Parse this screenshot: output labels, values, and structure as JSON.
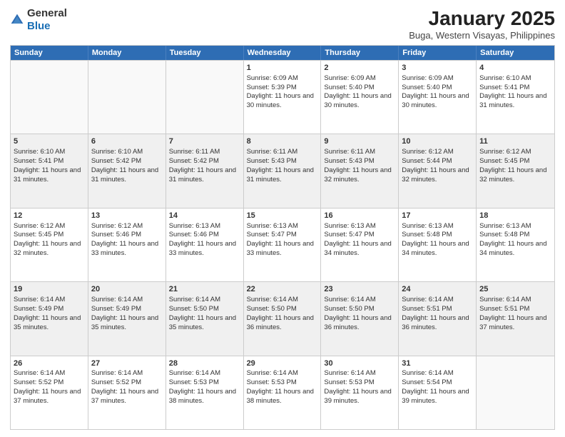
{
  "header": {
    "logo_general": "General",
    "logo_blue": "Blue",
    "title": "January 2025",
    "subtitle": "Buga, Western Visayas, Philippines"
  },
  "weekdays": [
    "Sunday",
    "Monday",
    "Tuesday",
    "Wednesday",
    "Thursday",
    "Friday",
    "Saturday"
  ],
  "weeks": [
    [
      {
        "day": "",
        "sunrise": "",
        "sunset": "",
        "daylight": "",
        "empty": true
      },
      {
        "day": "",
        "sunrise": "",
        "sunset": "",
        "daylight": "",
        "empty": true
      },
      {
        "day": "",
        "sunrise": "",
        "sunset": "",
        "daylight": "",
        "empty": true
      },
      {
        "day": "1",
        "sunrise": "Sunrise: 6:09 AM",
        "sunset": "Sunset: 5:39 PM",
        "daylight": "Daylight: 11 hours and 30 minutes.",
        "empty": false
      },
      {
        "day": "2",
        "sunrise": "Sunrise: 6:09 AM",
        "sunset": "Sunset: 5:40 PM",
        "daylight": "Daylight: 11 hours and 30 minutes.",
        "empty": false
      },
      {
        "day": "3",
        "sunrise": "Sunrise: 6:09 AM",
        "sunset": "Sunset: 5:40 PM",
        "daylight": "Daylight: 11 hours and 30 minutes.",
        "empty": false
      },
      {
        "day": "4",
        "sunrise": "Sunrise: 6:10 AM",
        "sunset": "Sunset: 5:41 PM",
        "daylight": "Daylight: 11 hours and 31 minutes.",
        "empty": false
      }
    ],
    [
      {
        "day": "5",
        "sunrise": "Sunrise: 6:10 AM",
        "sunset": "Sunset: 5:41 PM",
        "daylight": "Daylight: 11 hours and 31 minutes.",
        "empty": false
      },
      {
        "day": "6",
        "sunrise": "Sunrise: 6:10 AM",
        "sunset": "Sunset: 5:42 PM",
        "daylight": "Daylight: 11 hours and 31 minutes.",
        "empty": false
      },
      {
        "day": "7",
        "sunrise": "Sunrise: 6:11 AM",
        "sunset": "Sunset: 5:42 PM",
        "daylight": "Daylight: 11 hours and 31 minutes.",
        "empty": false
      },
      {
        "day": "8",
        "sunrise": "Sunrise: 6:11 AM",
        "sunset": "Sunset: 5:43 PM",
        "daylight": "Daylight: 11 hours and 31 minutes.",
        "empty": false
      },
      {
        "day": "9",
        "sunrise": "Sunrise: 6:11 AM",
        "sunset": "Sunset: 5:43 PM",
        "daylight": "Daylight: 11 hours and 32 minutes.",
        "empty": false
      },
      {
        "day": "10",
        "sunrise": "Sunrise: 6:12 AM",
        "sunset": "Sunset: 5:44 PM",
        "daylight": "Daylight: 11 hours and 32 minutes.",
        "empty": false
      },
      {
        "day": "11",
        "sunrise": "Sunrise: 6:12 AM",
        "sunset": "Sunset: 5:45 PM",
        "daylight": "Daylight: 11 hours and 32 minutes.",
        "empty": false
      }
    ],
    [
      {
        "day": "12",
        "sunrise": "Sunrise: 6:12 AM",
        "sunset": "Sunset: 5:45 PM",
        "daylight": "Daylight: 11 hours and 32 minutes.",
        "empty": false
      },
      {
        "day": "13",
        "sunrise": "Sunrise: 6:12 AM",
        "sunset": "Sunset: 5:46 PM",
        "daylight": "Daylight: 11 hours and 33 minutes.",
        "empty": false
      },
      {
        "day": "14",
        "sunrise": "Sunrise: 6:13 AM",
        "sunset": "Sunset: 5:46 PM",
        "daylight": "Daylight: 11 hours and 33 minutes.",
        "empty": false
      },
      {
        "day": "15",
        "sunrise": "Sunrise: 6:13 AM",
        "sunset": "Sunset: 5:47 PM",
        "daylight": "Daylight: 11 hours and 33 minutes.",
        "empty": false
      },
      {
        "day": "16",
        "sunrise": "Sunrise: 6:13 AM",
        "sunset": "Sunset: 5:47 PM",
        "daylight": "Daylight: 11 hours and 34 minutes.",
        "empty": false
      },
      {
        "day": "17",
        "sunrise": "Sunrise: 6:13 AM",
        "sunset": "Sunset: 5:48 PM",
        "daylight": "Daylight: 11 hours and 34 minutes.",
        "empty": false
      },
      {
        "day": "18",
        "sunrise": "Sunrise: 6:13 AM",
        "sunset": "Sunset: 5:48 PM",
        "daylight": "Daylight: 11 hours and 34 minutes.",
        "empty": false
      }
    ],
    [
      {
        "day": "19",
        "sunrise": "Sunrise: 6:14 AM",
        "sunset": "Sunset: 5:49 PM",
        "daylight": "Daylight: 11 hours and 35 minutes.",
        "empty": false
      },
      {
        "day": "20",
        "sunrise": "Sunrise: 6:14 AM",
        "sunset": "Sunset: 5:49 PM",
        "daylight": "Daylight: 11 hours and 35 minutes.",
        "empty": false
      },
      {
        "day": "21",
        "sunrise": "Sunrise: 6:14 AM",
        "sunset": "Sunset: 5:50 PM",
        "daylight": "Daylight: 11 hours and 35 minutes.",
        "empty": false
      },
      {
        "day": "22",
        "sunrise": "Sunrise: 6:14 AM",
        "sunset": "Sunset: 5:50 PM",
        "daylight": "Daylight: 11 hours and 36 minutes.",
        "empty": false
      },
      {
        "day": "23",
        "sunrise": "Sunrise: 6:14 AM",
        "sunset": "Sunset: 5:50 PM",
        "daylight": "Daylight: 11 hours and 36 minutes.",
        "empty": false
      },
      {
        "day": "24",
        "sunrise": "Sunrise: 6:14 AM",
        "sunset": "Sunset: 5:51 PM",
        "daylight": "Daylight: 11 hours and 36 minutes.",
        "empty": false
      },
      {
        "day": "25",
        "sunrise": "Sunrise: 6:14 AM",
        "sunset": "Sunset: 5:51 PM",
        "daylight": "Daylight: 11 hours and 37 minutes.",
        "empty": false
      }
    ],
    [
      {
        "day": "26",
        "sunrise": "Sunrise: 6:14 AM",
        "sunset": "Sunset: 5:52 PM",
        "daylight": "Daylight: 11 hours and 37 minutes.",
        "empty": false
      },
      {
        "day": "27",
        "sunrise": "Sunrise: 6:14 AM",
        "sunset": "Sunset: 5:52 PM",
        "daylight": "Daylight: 11 hours and 37 minutes.",
        "empty": false
      },
      {
        "day": "28",
        "sunrise": "Sunrise: 6:14 AM",
        "sunset": "Sunset: 5:53 PM",
        "daylight": "Daylight: 11 hours and 38 minutes.",
        "empty": false
      },
      {
        "day": "29",
        "sunrise": "Sunrise: 6:14 AM",
        "sunset": "Sunset: 5:53 PM",
        "daylight": "Daylight: 11 hours and 38 minutes.",
        "empty": false
      },
      {
        "day": "30",
        "sunrise": "Sunrise: 6:14 AM",
        "sunset": "Sunset: 5:53 PM",
        "daylight": "Daylight: 11 hours and 39 minutes.",
        "empty": false
      },
      {
        "day": "31",
        "sunrise": "Sunrise: 6:14 AM",
        "sunset": "Sunset: 5:54 PM",
        "daylight": "Daylight: 11 hours and 39 minutes.",
        "empty": false
      },
      {
        "day": "",
        "sunrise": "",
        "sunset": "",
        "daylight": "",
        "empty": true
      }
    ]
  ]
}
